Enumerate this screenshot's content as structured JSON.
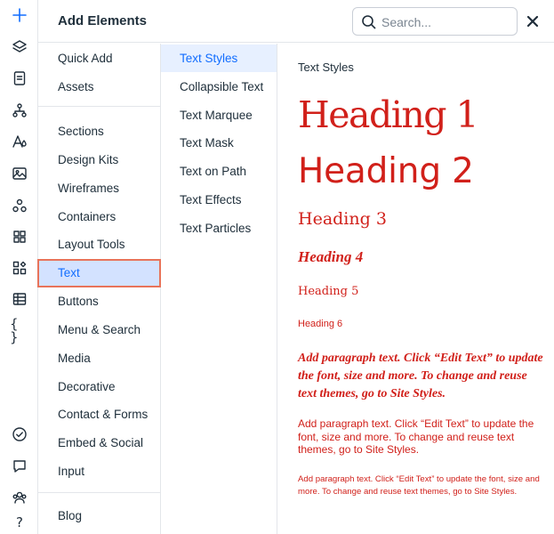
{
  "rail": {
    "icons": [
      {
        "name": "add-icon",
        "active": true
      },
      {
        "name": "layers-icon"
      },
      {
        "name": "pages-icon"
      },
      {
        "name": "site-structure-icon"
      },
      {
        "name": "theme-icon"
      },
      {
        "name": "media-icon"
      },
      {
        "name": "apps-icon"
      },
      {
        "name": "grid-icon"
      },
      {
        "name": "app-market-icon"
      },
      {
        "name": "cms-table-icon"
      },
      {
        "name": "code-braces-icon"
      },
      {
        "name": "checklist-icon"
      },
      {
        "name": "chat-icon"
      },
      {
        "name": "people-icon"
      },
      {
        "name": "help-icon"
      }
    ],
    "code_glyph": "{ }",
    "help_glyph": "?"
  },
  "header": {
    "title": "Add Elements",
    "search_placeholder": "Search...",
    "search_value": ""
  },
  "categories": {
    "group1": [
      "Quick Add",
      "Assets"
    ],
    "group2": [
      "Sections",
      "Design Kits",
      "Wireframes",
      "Containers",
      "Layout Tools",
      "Text",
      "Buttons",
      "Menu & Search",
      "Media",
      "Decorative",
      "Contact & Forms",
      "Embed & Social",
      "Input"
    ],
    "group3": [
      "Blog"
    ],
    "selected": "Text"
  },
  "subcategories": {
    "items": [
      "Text Styles",
      "Collapsible Text",
      "Text Marquee",
      "Text Mask",
      "Text on Path",
      "Text Effects",
      "Text Particles"
    ],
    "selected": "Text Styles"
  },
  "content": {
    "title": "Text Styles",
    "presets": {
      "h1": "Heading 1",
      "h2": "Heading 2",
      "h3": "Heading 3",
      "h4": "Heading 4",
      "h5": "Heading 5",
      "h6": "Heading 6",
      "p1": "Add paragraph text. Click “Edit Text” to update the font, size and more. To change and reuse text themes, go to Site Styles.",
      "p2": "Add paragraph text. Click “Edit Text” to update the font, size and more. To change and reuse text themes, go to Site Styles.",
      "p3": "Add paragraph text. Click “Edit Text” to update the font, size and more. To change and reuse text themes, go to Site Styles."
    }
  },
  "colors": {
    "accent": "#116dff",
    "selected_bg": "#d3e2ff",
    "highlight_outline": "#e8735a",
    "preset_text": "#d1201a"
  }
}
